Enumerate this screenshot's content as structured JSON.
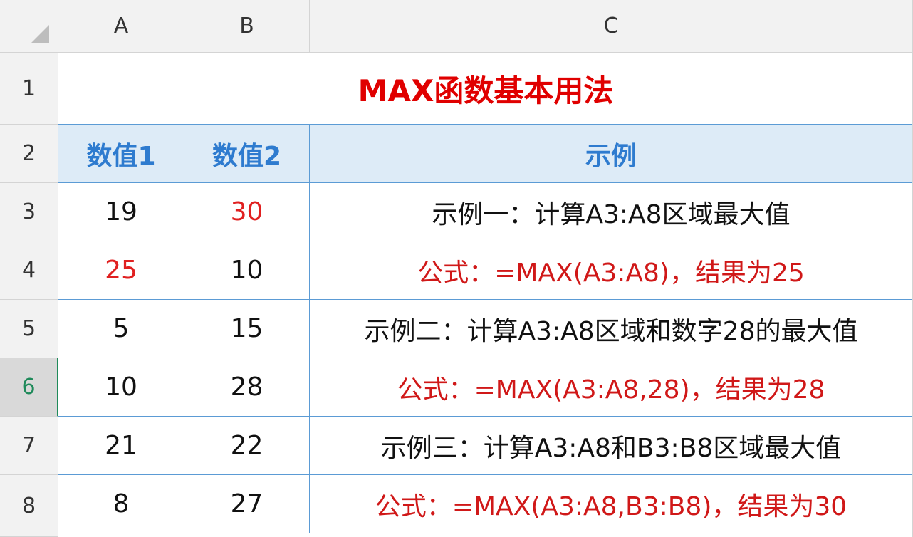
{
  "columns": [
    "A",
    "B",
    "C"
  ],
  "rows": [
    "1",
    "2",
    "3",
    "4",
    "5",
    "6",
    "7",
    "8"
  ],
  "title": "MAX函数基本用法",
  "headers": {
    "a": "数值1",
    "b": "数值2",
    "c": "示例"
  },
  "data": [
    {
      "a": "19",
      "b": "30",
      "c": "示例一：计算A3:A8区域最大值"
    },
    {
      "a": "25",
      "b": "10",
      "c": "公式：=MAX(A3:A8)，结果为25"
    },
    {
      "a": "5",
      "b": "15",
      "c": "示例二：计算A3:A8区域和数字28的最大值"
    },
    {
      "a": "10",
      "b": "28",
      "c": "公式：=MAX(A3:A8,28)，结果为28"
    },
    {
      "a": "21",
      "b": "22",
      "c": "示例三：计算A3:A8和B3:B8区域最大值"
    },
    {
      "a": "8",
      "b": "27",
      "c": "公式：=MAX(A3:A8,B3:B8)，结果为30"
    }
  ],
  "active_row": "6",
  "colors": {
    "title": "#e00000",
    "header_bg": "#ddebf7",
    "header_text": "#2e7bcf",
    "highlight": "#e02020",
    "border": "#5b9bd5",
    "active_row": "#1f8a5a"
  }
}
